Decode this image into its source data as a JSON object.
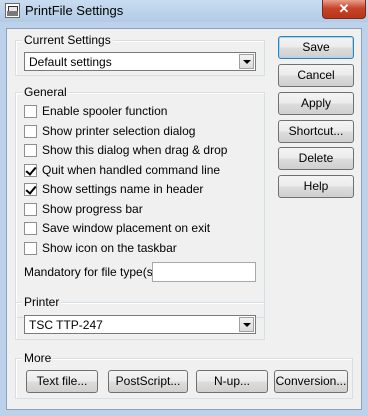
{
  "window": {
    "title": "PrintFile Settings",
    "close_label": "✕"
  },
  "current_settings": {
    "label": "Current Settings",
    "selected": "Default settings"
  },
  "general": {
    "label": "General",
    "options": [
      {
        "label": "Enable spooler function",
        "checked": false
      },
      {
        "label": "Show printer selection dialog",
        "checked": false
      },
      {
        "label": "Show this dialog when drag & drop",
        "checked": false
      },
      {
        "label": "Quit when handled command line",
        "checked": true
      },
      {
        "label": "Show settings name in header",
        "checked": true
      },
      {
        "label": "Show progress bar",
        "checked": false
      },
      {
        "label": "Save window placement on exit",
        "checked": false
      },
      {
        "label": "Show icon on the taskbar",
        "checked": false
      }
    ],
    "mandatory_label": "Mandatory for file type(s):",
    "mandatory_value": ""
  },
  "printer": {
    "label": "Printer",
    "selected": "TSC TTP-247"
  },
  "more": {
    "label": "More",
    "buttons": [
      "Text file...",
      "PostScript...",
      "N-up...",
      "Conversion..."
    ]
  },
  "side_buttons": [
    "Save",
    "Cancel",
    "Apply",
    "Shortcut...",
    "Delete",
    "Help"
  ]
}
